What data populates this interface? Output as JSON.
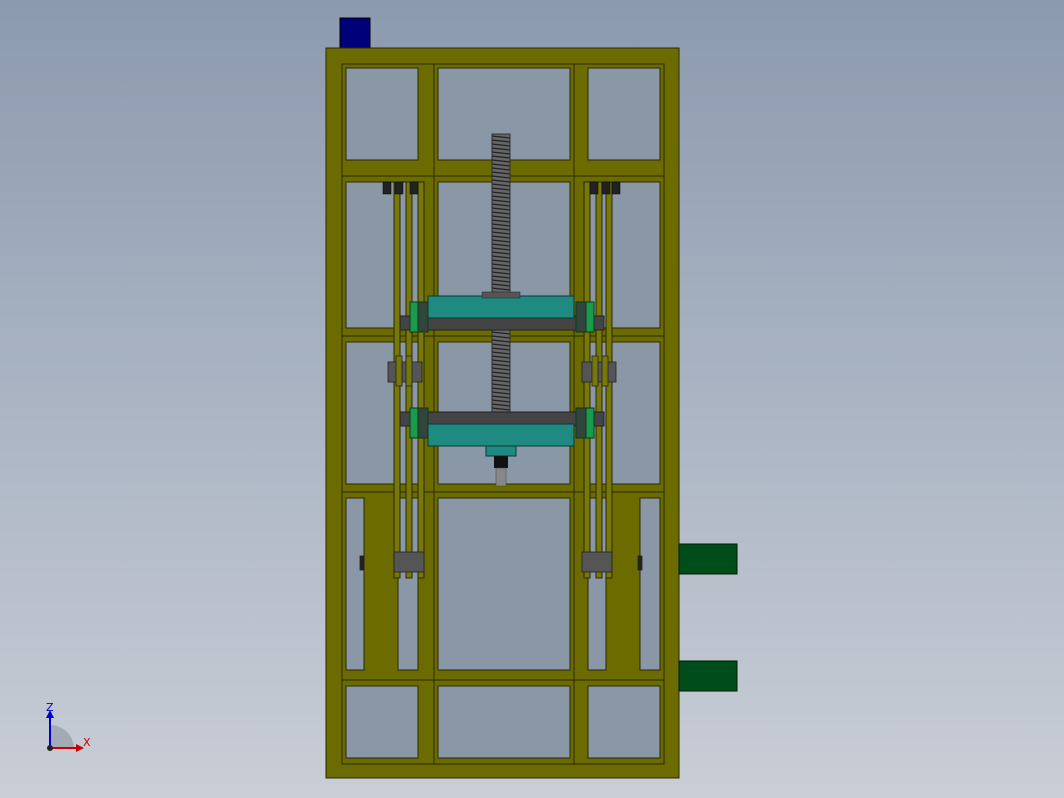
{
  "viewport": {
    "background_top": "#8c9aae",
    "background_bottom": "#c9ced6"
  },
  "model": {
    "frame_color": "#6b6b00",
    "panel_color": "#8a97a6",
    "block_color": "#00007a",
    "carriage_color": "#1f8a82",
    "bracket_color": "#004d1a",
    "screw_color": "#555555"
  },
  "triad": {
    "z_label": "Z",
    "x_label": "X",
    "z_color": "#0000cc",
    "x_color": "#cc0000"
  }
}
